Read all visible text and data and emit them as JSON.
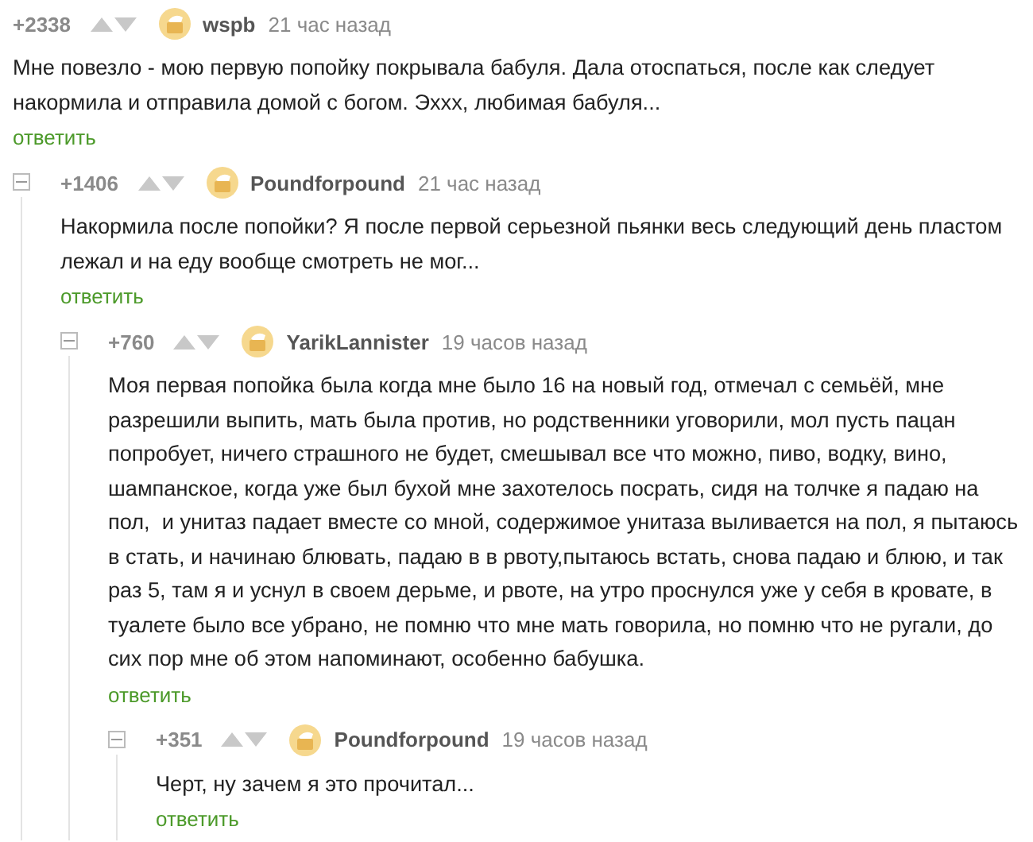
{
  "comments": [
    {
      "rating": "+2338",
      "author": "wspb",
      "time": "21 час назад",
      "text": "Мне повезло - мою первую попойку покрывала бабуля. Дала отоспаться, после как следует накормила и отправила домой с богом. Эххх, любимая бабуля...",
      "reply": "ответить",
      "children": [
        {
          "rating": "+1406",
          "author": "Poundforpound",
          "time": "21 час назад",
          "text": "Накормила после попойки? Я после первой серьезной пьянки весь следующий день пластом лежал и на еду вообще смотреть не мог...",
          "reply": "ответить",
          "children": [
            {
              "rating": "+760",
              "author": "YarikLannister",
              "time": "19 часов назад",
              "text": "Моя первая попойка была когда мне было 16 на новый год, отмечал с семьёй, мне разрешили выпить, мать была против, но родственники уговорили, мол пусть пацан попробует, ничего страшного не будет, смешывал все что можно, пиво, водку, вино, шампанское, когда уже был бухой мне захотелось посрать, сидя на толчке я падаю на пол,  и унитаз падает вместе со мной, содержимое унитаза выливается на пол, я пытаюсь в стать, и начинаю блювать, падаю в в рвоту,пытаюсь встать, снова падаю и блюю, и так раз 5, там я и уснул в своем дерьме, и рвоте, на утро проснулся уже у себя в кровате, в туалете было все убрано, не помню что мне мать говорила, но помню что не ругали, до сих пор мне об этом напоминают, особенно бабушка.",
              "reply": "ответить",
              "children": [
                {
                  "rating": "+351",
                  "author": "Poundforpound",
                  "time": "19 часов назад",
                  "text": "Черт, ну зачем я это прочитал...",
                  "reply": "ответить"
                }
              ]
            }
          ]
        }
      ]
    }
  ]
}
